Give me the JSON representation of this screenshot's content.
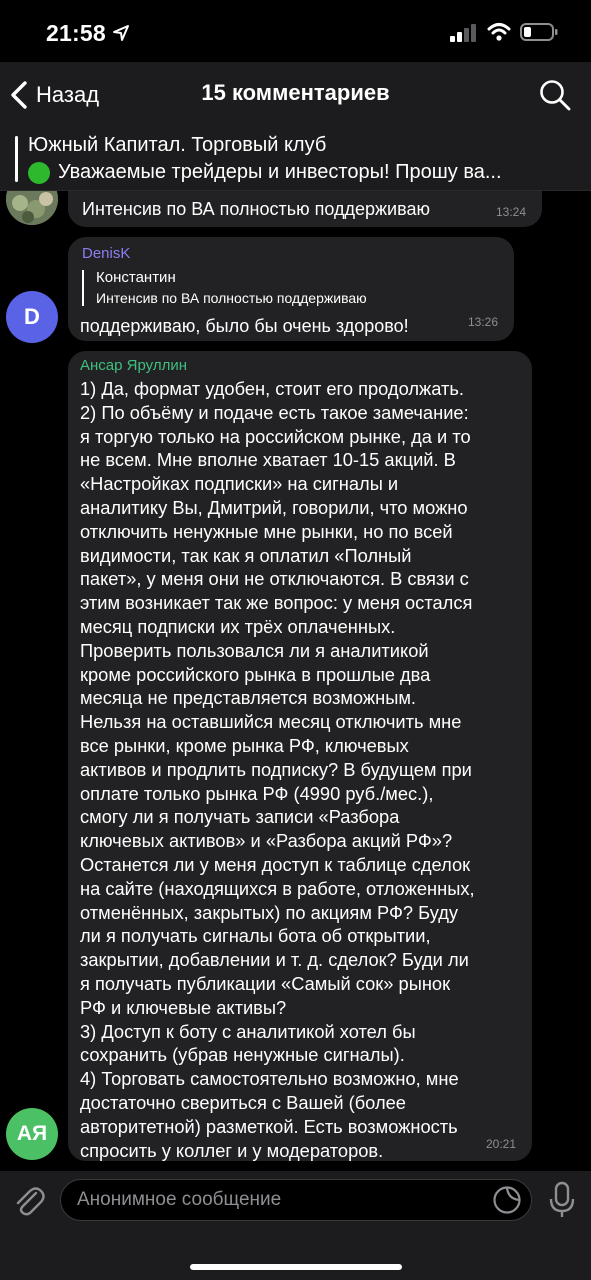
{
  "status_bar": {
    "time": "21:58"
  },
  "nav": {
    "back_label": "Назад",
    "title": "15 комментариев"
  },
  "pinned": {
    "title": "Южный Капитал. Торговый клуб",
    "text": "Уважаемые трейдеры и инвесторы! Прошу ва..."
  },
  "messages": [
    {
      "text": "Интенсив по ВА полностью поддерживаю",
      "time": "13:24"
    },
    {
      "sender": "DenisK",
      "avatar_initials": "D",
      "reply_to": {
        "name": "Константин",
        "text": "Интенсив по ВА полностью поддерживаю"
      },
      "text": "поддерживаю, было бы очень здорово!",
      "time": "13:26"
    },
    {
      "sender": "Ансар Яруллин",
      "avatar_initials": "АЯ",
      "lines": [
        "1) Да, формат удобен, стоит его продолжать.",
        "2) По объёму и подаче есть такое замечание:",
        "я торгую только на российском рынке, да и то",
        "не всем. Мне вполне хватает 10-15 акций. В",
        "«Настройках подписки» на сигналы и",
        "аналитику Вы, Дмитрий, говорили, что можно",
        "отключить ненужные мне рынки, но по всей",
        "видимости, так как я оплатил «Полный",
        "пакет», у меня они не отключаются. В связи с",
        "этим возникает так же вопрос: у меня остался",
        "месяц подписки их трёх оплаченных.",
        "Проверить пользовался ли я аналитикой",
        "кроме российского рынка в прошлые два",
        "месяца не представляется возможным.",
        "Нельзя на оставшийся месяц отключить мне",
        "все рынки, кроме рынка РФ, ключевых",
        "активов и продлить подписку? В будущем при",
        "оплате только рынка РФ (4990 руб./мес.),",
        "смогу ли я получать записи «Разбора",
        "ключевых активов» и «Разбора акций РФ»?",
        "Останется ли у меня доступ к таблице сделок",
        "на сайте (находящихся в работе, отложенных,",
        "отменённых, закрытых) по акциям РФ? Буду",
        "ли я получать сигналы бота об открытии,",
        "закрытии, добавлении и т. д. сделок? Буди ли",
        "я получать публикации «Самый сок» рынок",
        "РФ и ключевые активы?",
        "3) Доступ к боту с аналитикой хотел бы",
        "сохранить (убрав ненужные сигналы).",
        "4) Торговать самостоятельно возможно, мне",
        "достаточно свериться с Вашей (более",
        "авторитетной) разметкой. Есть возможность",
        "спросить у коллег и у модераторов."
      ],
      "time": "20:21"
    }
  ],
  "composer": {
    "placeholder": "Анонимное сообщение"
  },
  "colors": {
    "background": "#000000",
    "bar": "#1c1c1e",
    "bubble": "#222224",
    "sender_denisk": "#8a7ff0",
    "sender_ansar": "#3fbf7f",
    "avatar_d": "#5a62e6",
    "avatar_ay": "#4cc065",
    "pinned_dot": "#2eb82e"
  },
  "icons": [
    "location-arrow-icon",
    "signal-icon",
    "wifi-icon",
    "battery-icon",
    "chevron-left-icon",
    "search-icon",
    "paperclip-icon",
    "sticker-icon",
    "microphone-icon"
  ]
}
